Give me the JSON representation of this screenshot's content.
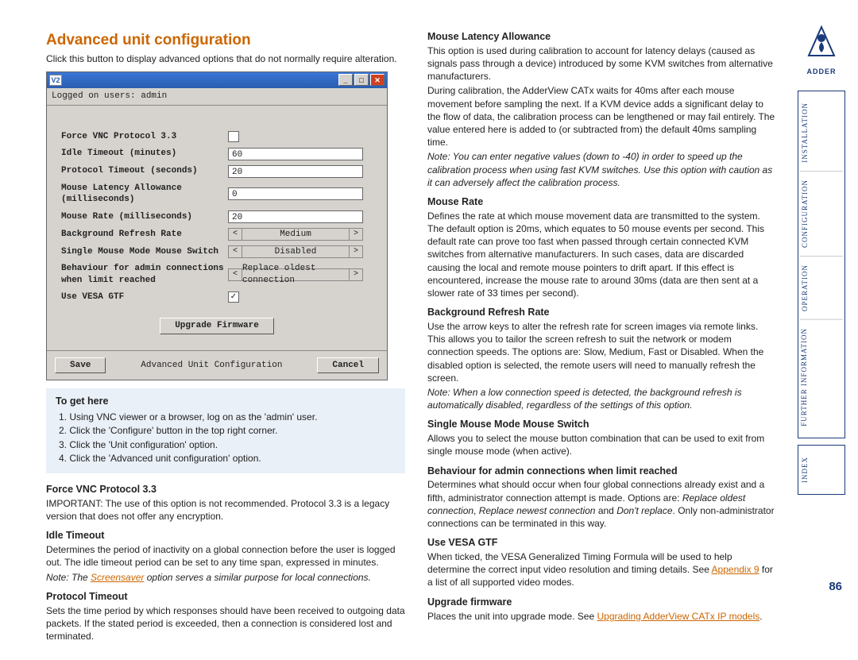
{
  "page": {
    "title": "Advanced unit configuration",
    "intro": "Click this button to display advanced options that do not normally require alteration.",
    "number": "86"
  },
  "dialog": {
    "vnc_badge": "V2",
    "status": "Logged on users: admin",
    "footer_title": "Advanced Unit Configuration",
    "save": "Save",
    "cancel": "Cancel",
    "upgrade": "Upgrade Firmware",
    "fields": {
      "force_vnc": {
        "label": "Force VNC Protocol 3.3",
        "checked": false
      },
      "idle_timeout": {
        "label": "Idle Timeout (minutes)",
        "value": "60"
      },
      "protocol_timeout": {
        "label": "Protocol Timeout (seconds)",
        "value": "20"
      },
      "mouse_latency": {
        "label": "Mouse Latency Allowance (milliseconds)",
        "value": "0"
      },
      "mouse_rate": {
        "label": "Mouse Rate (milliseconds)",
        "value": "20"
      },
      "bg_refresh": {
        "label": "Background Refresh Rate",
        "value": "Medium"
      },
      "single_mouse": {
        "label": "Single Mouse Mode Mouse Switch",
        "value": "Disabled"
      },
      "admin_behaviour": {
        "label": "Behaviour for admin connections when limit reached",
        "value": "Replace oldest connection"
      },
      "vesa": {
        "label": "Use VESA GTF",
        "checked": true
      }
    }
  },
  "togethere": {
    "heading": "To get here",
    "steps": [
      "Using VNC viewer or a browser, log on as the 'admin' user.",
      "Click the 'Configure' button in the top right corner.",
      "Click the 'Unit configuration' option.",
      "Click the 'Advanced unit configuration' option."
    ]
  },
  "left_sections": {
    "force_vnc": {
      "heading": "Force VNC Protocol 3.3",
      "text": "IMPORTANT: The use of this option is not recommended. Protocol 3.3 is a legacy version that does not offer any encryption."
    },
    "idle_timeout": {
      "heading": "Idle Timeout",
      "text": "Determines the period of inactivity on a global connection before the user is logged out. The idle timeout period can be set to any time span, expressed in minutes.",
      "note_prefix": "Note: The ",
      "note_link": "Screensaver",
      "note_suffix": " option serves a similar purpose for local connections."
    },
    "protocol_timeout": {
      "heading": "Protocol Timeout",
      "text": "Sets the time period by which responses should have been received to outgoing data packets. If the stated period is exceeded, then a connection is considered lost and terminated."
    }
  },
  "right_sections": {
    "mouse_latency": {
      "heading": "Mouse Latency Allowance",
      "p1": "This option is used during calibration to account for latency delays (caused as signals pass through a device) introduced by some KVM switches from alternative manufacturers.",
      "p2": "During calibration, the AdderView CATx waits for 40ms after each mouse movement before sampling the next. If a KVM device adds a significant delay to the flow of data, the calibration process can be lengthened or may fail entirely. The value entered here is added to (or subtracted from) the default 40ms sampling time.",
      "note": "Note: You can enter negative values (down to -40) in order to speed up the calibration process when using fast KVM switches. Use this option with caution as it can adversely affect the calibration process."
    },
    "mouse_rate": {
      "heading": "Mouse Rate",
      "text": "Defines the rate at which mouse movement data are transmitted to the system. The default option is 20ms, which equates to 50 mouse events per second. This default rate can prove too fast when passed through certain connected KVM switches from alternative manufacturers. In such cases, data are discarded causing the local and remote mouse pointers to drift apart. If this effect is encountered, increase the mouse rate to around 30ms (data are then sent at a slower rate of 33 times per second)."
    },
    "bg_refresh": {
      "heading": "Background Refresh Rate",
      "text": "Use the arrow keys to alter the refresh rate for screen images via remote links. This allows you to tailor the screen refresh to suit the network or modem connection speeds. The options are: Slow, Medium, Fast or Disabled. When the disabled option is selected, the remote users will need to manually refresh the screen.",
      "note": "Note: When a low connection speed is detected, the background refresh is automatically disabled, regardless of the settings of this option."
    },
    "single_mouse": {
      "heading": "Single Mouse Mode Mouse Switch",
      "text": "Allows you to select the mouse button combination that can be used to exit from single mouse mode (when active)."
    },
    "admin_behaviour": {
      "heading": "Behaviour for admin connections when limit reached",
      "text_pre": "Determines what should occur when four global connections already exist and a fifth, administrator connection attempt is made. Options are: ",
      "opt1": "Replace oldest connection",
      "sep1": ", ",
      "opt2": "Replace newest connection",
      "sep2": " and ",
      "opt3": "Don't replace",
      "text_post": ". Only non-administrator connections can be terminated in this way."
    },
    "vesa": {
      "heading": "Use VESA GTF",
      "text_pre": "When ticked, the VESA Generalized Timing Formula will be used to help determine the correct input video resolution and timing details. See ",
      "link": "Appendix 9",
      "text_post": " for a list of all supported video modes."
    },
    "upgrade": {
      "heading": "Upgrade firmware",
      "text_pre": "Places the unit into upgrade mode. See ",
      "link": "Upgrading AdderView CATx IP models",
      "text_post": "."
    }
  },
  "sidebar": {
    "brand": "ADDER",
    "nav": [
      "INSTALLATION",
      "CONFIGURATION",
      "OPERATION",
      "FURTHER INFORMATION",
      "INDEX"
    ]
  }
}
